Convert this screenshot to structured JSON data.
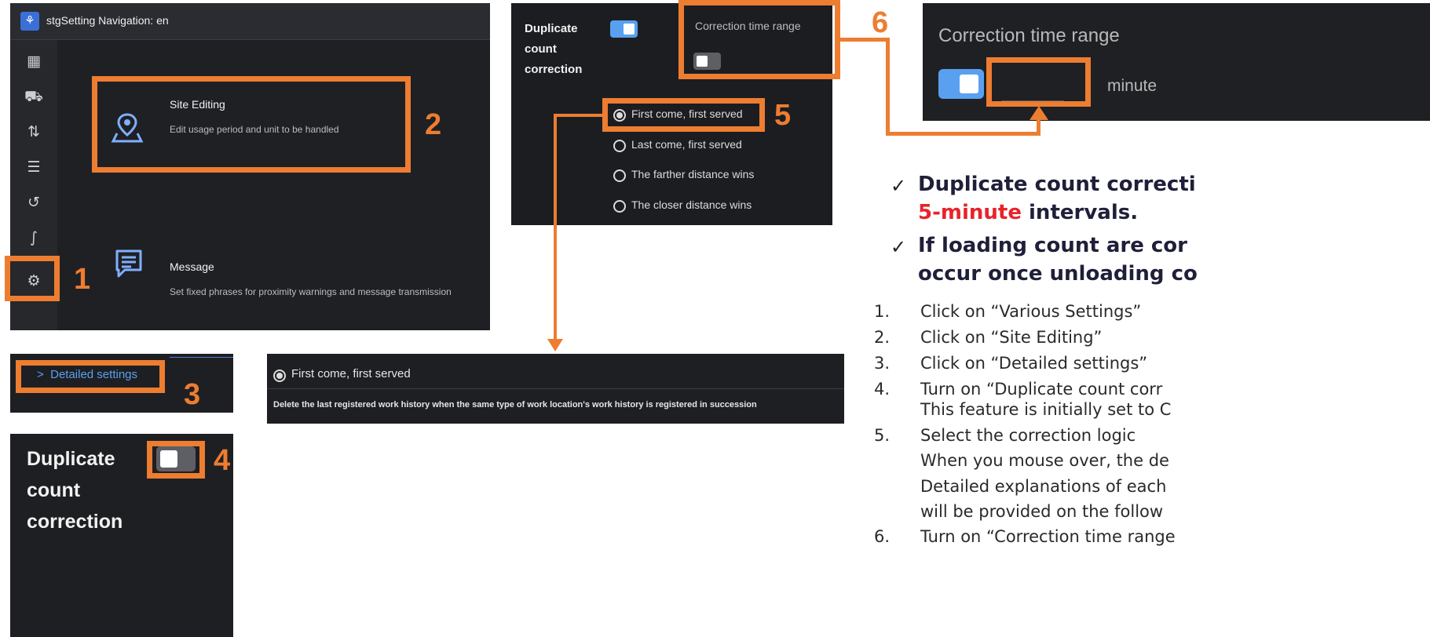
{
  "nav": {
    "title": "stgSetting Navigation: en",
    "rail_icons": [
      "map-icon",
      "truck-icon",
      "sort-icon",
      "list-icon",
      "history-icon",
      "route-icon",
      "gear-icon"
    ],
    "site_editing": {
      "title": "Site Editing",
      "desc": "Edit usage period and unit to be handled"
    },
    "message": {
      "title": "Message",
      "desc": "Set fixed phrases for proximity warnings and message transmission"
    }
  },
  "options": {
    "dup_label": [
      "Duplicate",
      "count",
      "correction"
    ],
    "time_range_label": "Correction time range",
    "radios": [
      {
        "label": "First come, first served",
        "selected": true
      },
      {
        "label": "Last come, first served",
        "selected": false
      },
      {
        "label": "The farther distance wins",
        "selected": false
      },
      {
        "label": "The closer distance wins",
        "selected": false
      }
    ]
  },
  "time_range": {
    "label": "Correction time range",
    "unit": "minute"
  },
  "detailed": {
    "label": "Detailed settings"
  },
  "tooltip": {
    "option": "First come, first served",
    "desc": "Delete the last registered work history when the same type of work location's work history is registered in succession"
  },
  "dup_big": {
    "lines": [
      "Duplicate",
      "count",
      "correction"
    ]
  },
  "callouts": [
    "1",
    "2",
    "3",
    "4",
    "5",
    "6"
  ],
  "bullets": {
    "b1_line1": "Duplicate count correcti",
    "b1_line2_red": "5-minute",
    "b1_line2_rest": " intervals.",
    "b2_line1": "If loading count are cor",
    "b2_line2": "occur once unloading co"
  },
  "steps": [
    {
      "num": "1.",
      "text": "Click on “Various Settings”"
    },
    {
      "num": "2.",
      "text": "Click on “Site Editing”"
    },
    {
      "num": "3.",
      "text": "Click on “Detailed settings”"
    },
    {
      "num": "4.",
      "text": "Turn on “Duplicate count corr"
    },
    {
      "num": "",
      "text": "This feature is initially set to C"
    },
    {
      "num": "5.",
      "text": "Select the correction logic"
    },
    {
      "num": "",
      "text": "When you mouse over, the de"
    },
    {
      "num": "",
      "text": "Detailed explanations of each"
    },
    {
      "num": "",
      "text": "will be provided on the follow"
    },
    {
      "num": "6.",
      "text": "Turn on “Correction time range"
    }
  ],
  "colors": {
    "accent": "#ed7d31",
    "toggle_on": "#5aa0f0",
    "panel_bg": "#1f2024",
    "highlight_red": "#e8232a"
  }
}
